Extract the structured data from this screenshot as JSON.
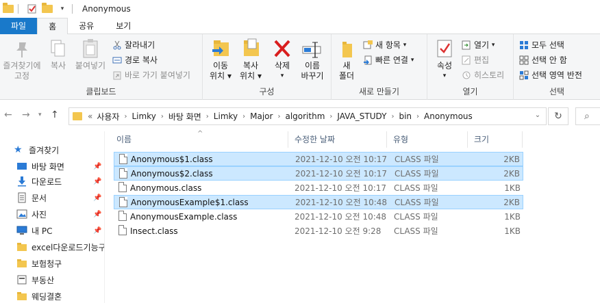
{
  "window": {
    "title": "Anonymous"
  },
  "tabs": {
    "file": "파일",
    "home": "홈",
    "share": "공유",
    "view": "보기"
  },
  "ribbon": {
    "clipboard": {
      "label": "클립보드",
      "pin_quick_line1": "즐겨찾기에",
      "pin_quick_line2": "고정",
      "copy": "복사",
      "paste": "붙여넣기",
      "cut": "잘라내기",
      "copy_path": "경로 복사",
      "paste_shortcut": "바로 가기 붙여넣기"
    },
    "organize": {
      "label": "구성",
      "move_line1": "이동",
      "move_line2": "위치",
      "copyto_line1": "복사",
      "copyto_line2": "위치",
      "delete": "삭제",
      "rename_line1": "이름",
      "rename_line2": "바꾸기"
    },
    "new": {
      "label": "새로 만들기",
      "new_folder_line1": "새",
      "new_folder_line2": "폴더",
      "new_item": "새 항목",
      "easy_access": "빠른 연결"
    },
    "open": {
      "label": "열기",
      "properties": "속성",
      "open": "열기",
      "edit": "편집",
      "history": "히스토리"
    },
    "select": {
      "label": "선택",
      "select_all": "모두 선택",
      "select_none": "선택 안 함",
      "invert": "선택 영역 반전"
    }
  },
  "address": {
    "prefix": "«",
    "crumbs": [
      "사용자",
      "Limky",
      "바탕 화면",
      "Limky",
      "Major",
      "algorithm",
      "JAVA_STUDY",
      "bin",
      "Anonymous"
    ]
  },
  "nav": {
    "quick_access": "즐겨찾기",
    "items": [
      {
        "label": "바탕 화면",
        "pinned": true
      },
      {
        "label": "다운로드",
        "pinned": true
      },
      {
        "label": "문서",
        "pinned": true
      },
      {
        "label": "사진",
        "pinned": true
      },
      {
        "label": "내 PC",
        "pinned": true
      },
      {
        "label": "excel다운로드기능구",
        "pinned": false
      },
      {
        "label": "보험청구",
        "pinned": false
      },
      {
        "label": "부동산",
        "pinned": false
      },
      {
        "label": "웨딩결혼",
        "pinned": false
      }
    ]
  },
  "columns": {
    "name": "이름",
    "date": "수정한 날짜",
    "type": "유형",
    "size": "크기"
  },
  "files": [
    {
      "name": "Anonymous$1.class",
      "date": "2021-12-10 오전 10:17",
      "type": "CLASS 파일",
      "size": "2KB",
      "selected": true
    },
    {
      "name": "Anonymous$2.class",
      "date": "2021-12-10 오전 10:17",
      "type": "CLASS 파일",
      "size": "2KB",
      "selected": true
    },
    {
      "name": "Anonymous.class",
      "date": "2021-12-10 오전 10:17",
      "type": "CLASS 파일",
      "size": "1KB",
      "selected": false
    },
    {
      "name": "AnonymousExample$1.class",
      "date": "2021-12-10 오전 10:48",
      "type": "CLASS 파일",
      "size": "2KB",
      "selected": true
    },
    {
      "name": "AnonymousExample.class",
      "date": "2021-12-10 오전 10:48",
      "type": "CLASS 파일",
      "size": "1KB",
      "selected": false
    },
    {
      "name": "Insect.class",
      "date": "2021-12-10 오전 9:28",
      "type": "CLASS 파일",
      "size": "1KB",
      "selected": false
    }
  ],
  "colors": {
    "accent": "#1979ca",
    "selection": "#cce8ff",
    "selection_border": "#99d1ff",
    "folder": "#f3c64f"
  }
}
